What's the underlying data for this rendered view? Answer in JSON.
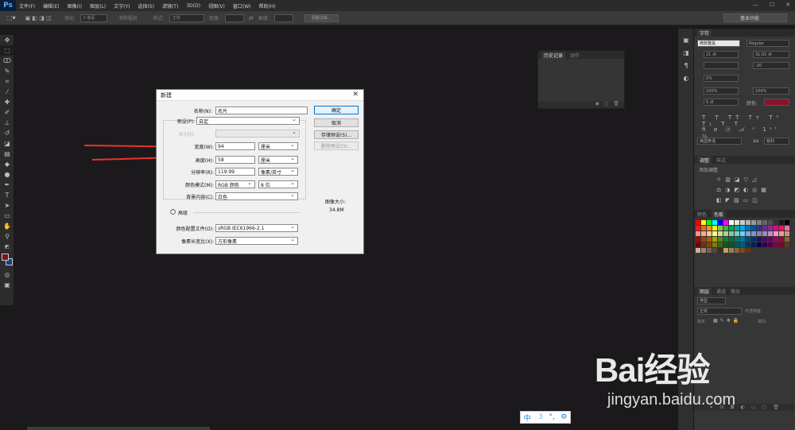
{
  "app": {
    "logo": "Ps"
  },
  "menubar": {
    "items": [
      "文件(F)",
      "编辑(E)",
      "图像(I)",
      "图层(L)",
      "文字(Y)",
      "选择(S)",
      "滤镜(T)",
      "3D(D)",
      "视图(V)",
      "窗口(W)",
      "帮助(H)"
    ]
  },
  "options": {
    "feather_label": "羽化:",
    "feather_value": "0 像素",
    "antialias_label": "消除锯齿",
    "style_label": "样式:",
    "style_value": "正常",
    "width_label": "宽度:",
    "height_label": "高度:",
    "refine_label": "调整边缘...",
    "workspace": "基本功能"
  },
  "history": {
    "tabs": [
      "历史记录",
      "动作"
    ]
  },
  "dialog": {
    "title": "新建",
    "name_label": "名称(N):",
    "name_value": "名片",
    "preset_label": "预设(P):",
    "preset_value": "自定",
    "size_label": "大小(I):",
    "width_label": "宽度(W):",
    "width_value": "94",
    "width_unit": "厘米",
    "height_label": "高度(H):",
    "height_value": "58",
    "height_unit": "厘米",
    "resolution_label": "分辨率(R):",
    "resolution_value": "119.99",
    "resolution_unit": "像素/英寸",
    "colormode_label": "颜色模式(M):",
    "colormode_value": "RGB 颜色",
    "bitdepth_value": "8 位",
    "background_label": "背景内容(C):",
    "background_value": "白色",
    "advanced_label": "高级",
    "profile_label": "颜色配置文件(O):",
    "profile_value": "sRGB IEC61966-2.1",
    "aspect_label": "像素长宽比(X):",
    "aspect_value": "方形像素",
    "ok": "确定",
    "cancel": "取消",
    "save_preset": "存储预设(S)...",
    "delete_preset": "删除预设(D)...",
    "image_size_label": "图像大小:",
    "image_size_value": "34.8M"
  },
  "char_panel": {
    "tabs": [
      "字符"
    ],
    "font_family": "微软雅黑",
    "font_style": "Regular",
    "font_size": "21 点",
    "leading": "31.01 点",
    "tracking": "-20",
    "scale_v": "100%",
    "scale_h": "100%",
    "baseline": "0 点",
    "color_label": "颜色:",
    "vscale": "0%",
    "language": "美国英语",
    "aa": "aa",
    "aa_mode": "锐利"
  },
  "adjust_panel": {
    "tabs": [
      "调整",
      "样式"
    ],
    "add_label": "添加调整"
  },
  "swatch_panel": {
    "tabs": [
      "颜色",
      "色板"
    ]
  },
  "layers_panel": {
    "tabs": [
      "图层",
      "通道",
      "路径"
    ],
    "kind": "类型",
    "blend": "正常",
    "opacity_label": "不透明度:",
    "lock_label": "锁定:",
    "fill_label": "填充:"
  },
  "ime": {
    "lang": "中",
    "moon": "☽",
    "dot": "°,",
    "gear": "⚙"
  },
  "watermark": {
    "word": "Bai经验",
    "url": "jingyan.baidu.com"
  },
  "colors": {
    "fg": "#7a1020",
    "bg": "#1a3c8c",
    "arrow": "#e8332b",
    "accent": "#0078d7"
  }
}
